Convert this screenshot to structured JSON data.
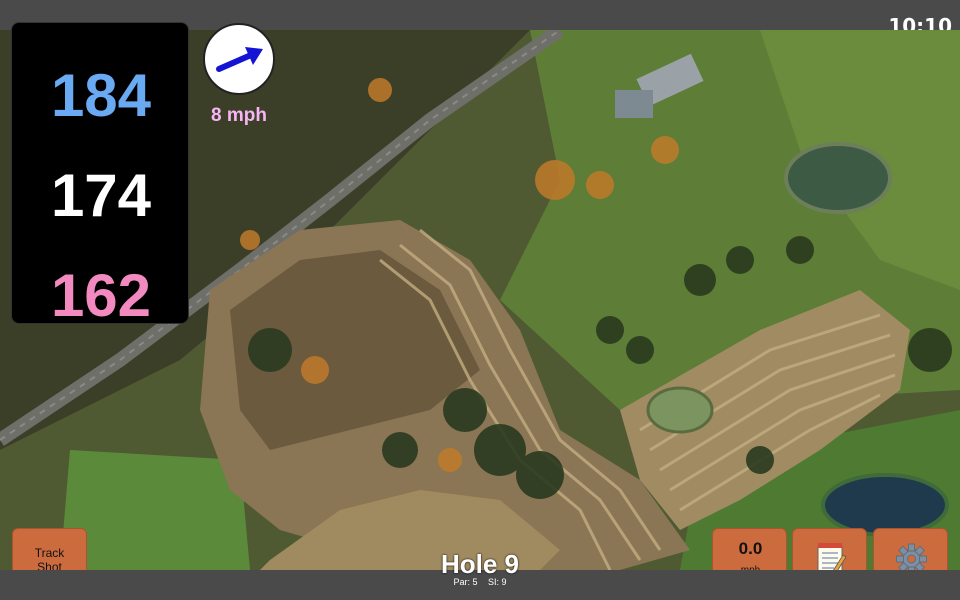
{
  "status": {
    "time": "10:10"
  },
  "distances": {
    "back": "184",
    "middle": "174",
    "front": "162"
  },
  "wind": {
    "speed": "8 mph",
    "direction_icon": "arrow-right-up-icon"
  },
  "buttons": {
    "track_shot_line1": "Track",
    "track_shot_line2": "Shot",
    "speed_value": "0.0",
    "speed_unit": "mph",
    "notes_icon": "notepad-icon",
    "settings_icon": "gear-icon"
  },
  "hole": {
    "title": "Hole 9",
    "par": "Par: 5",
    "si": "SI: 9"
  },
  "colors": {
    "back_distance": "#6aaaf2",
    "middle_distance": "#ffffff",
    "front_distance": "#f28ac0",
    "wind_text": "#f8b4f4",
    "button": "#cc6b3d"
  }
}
